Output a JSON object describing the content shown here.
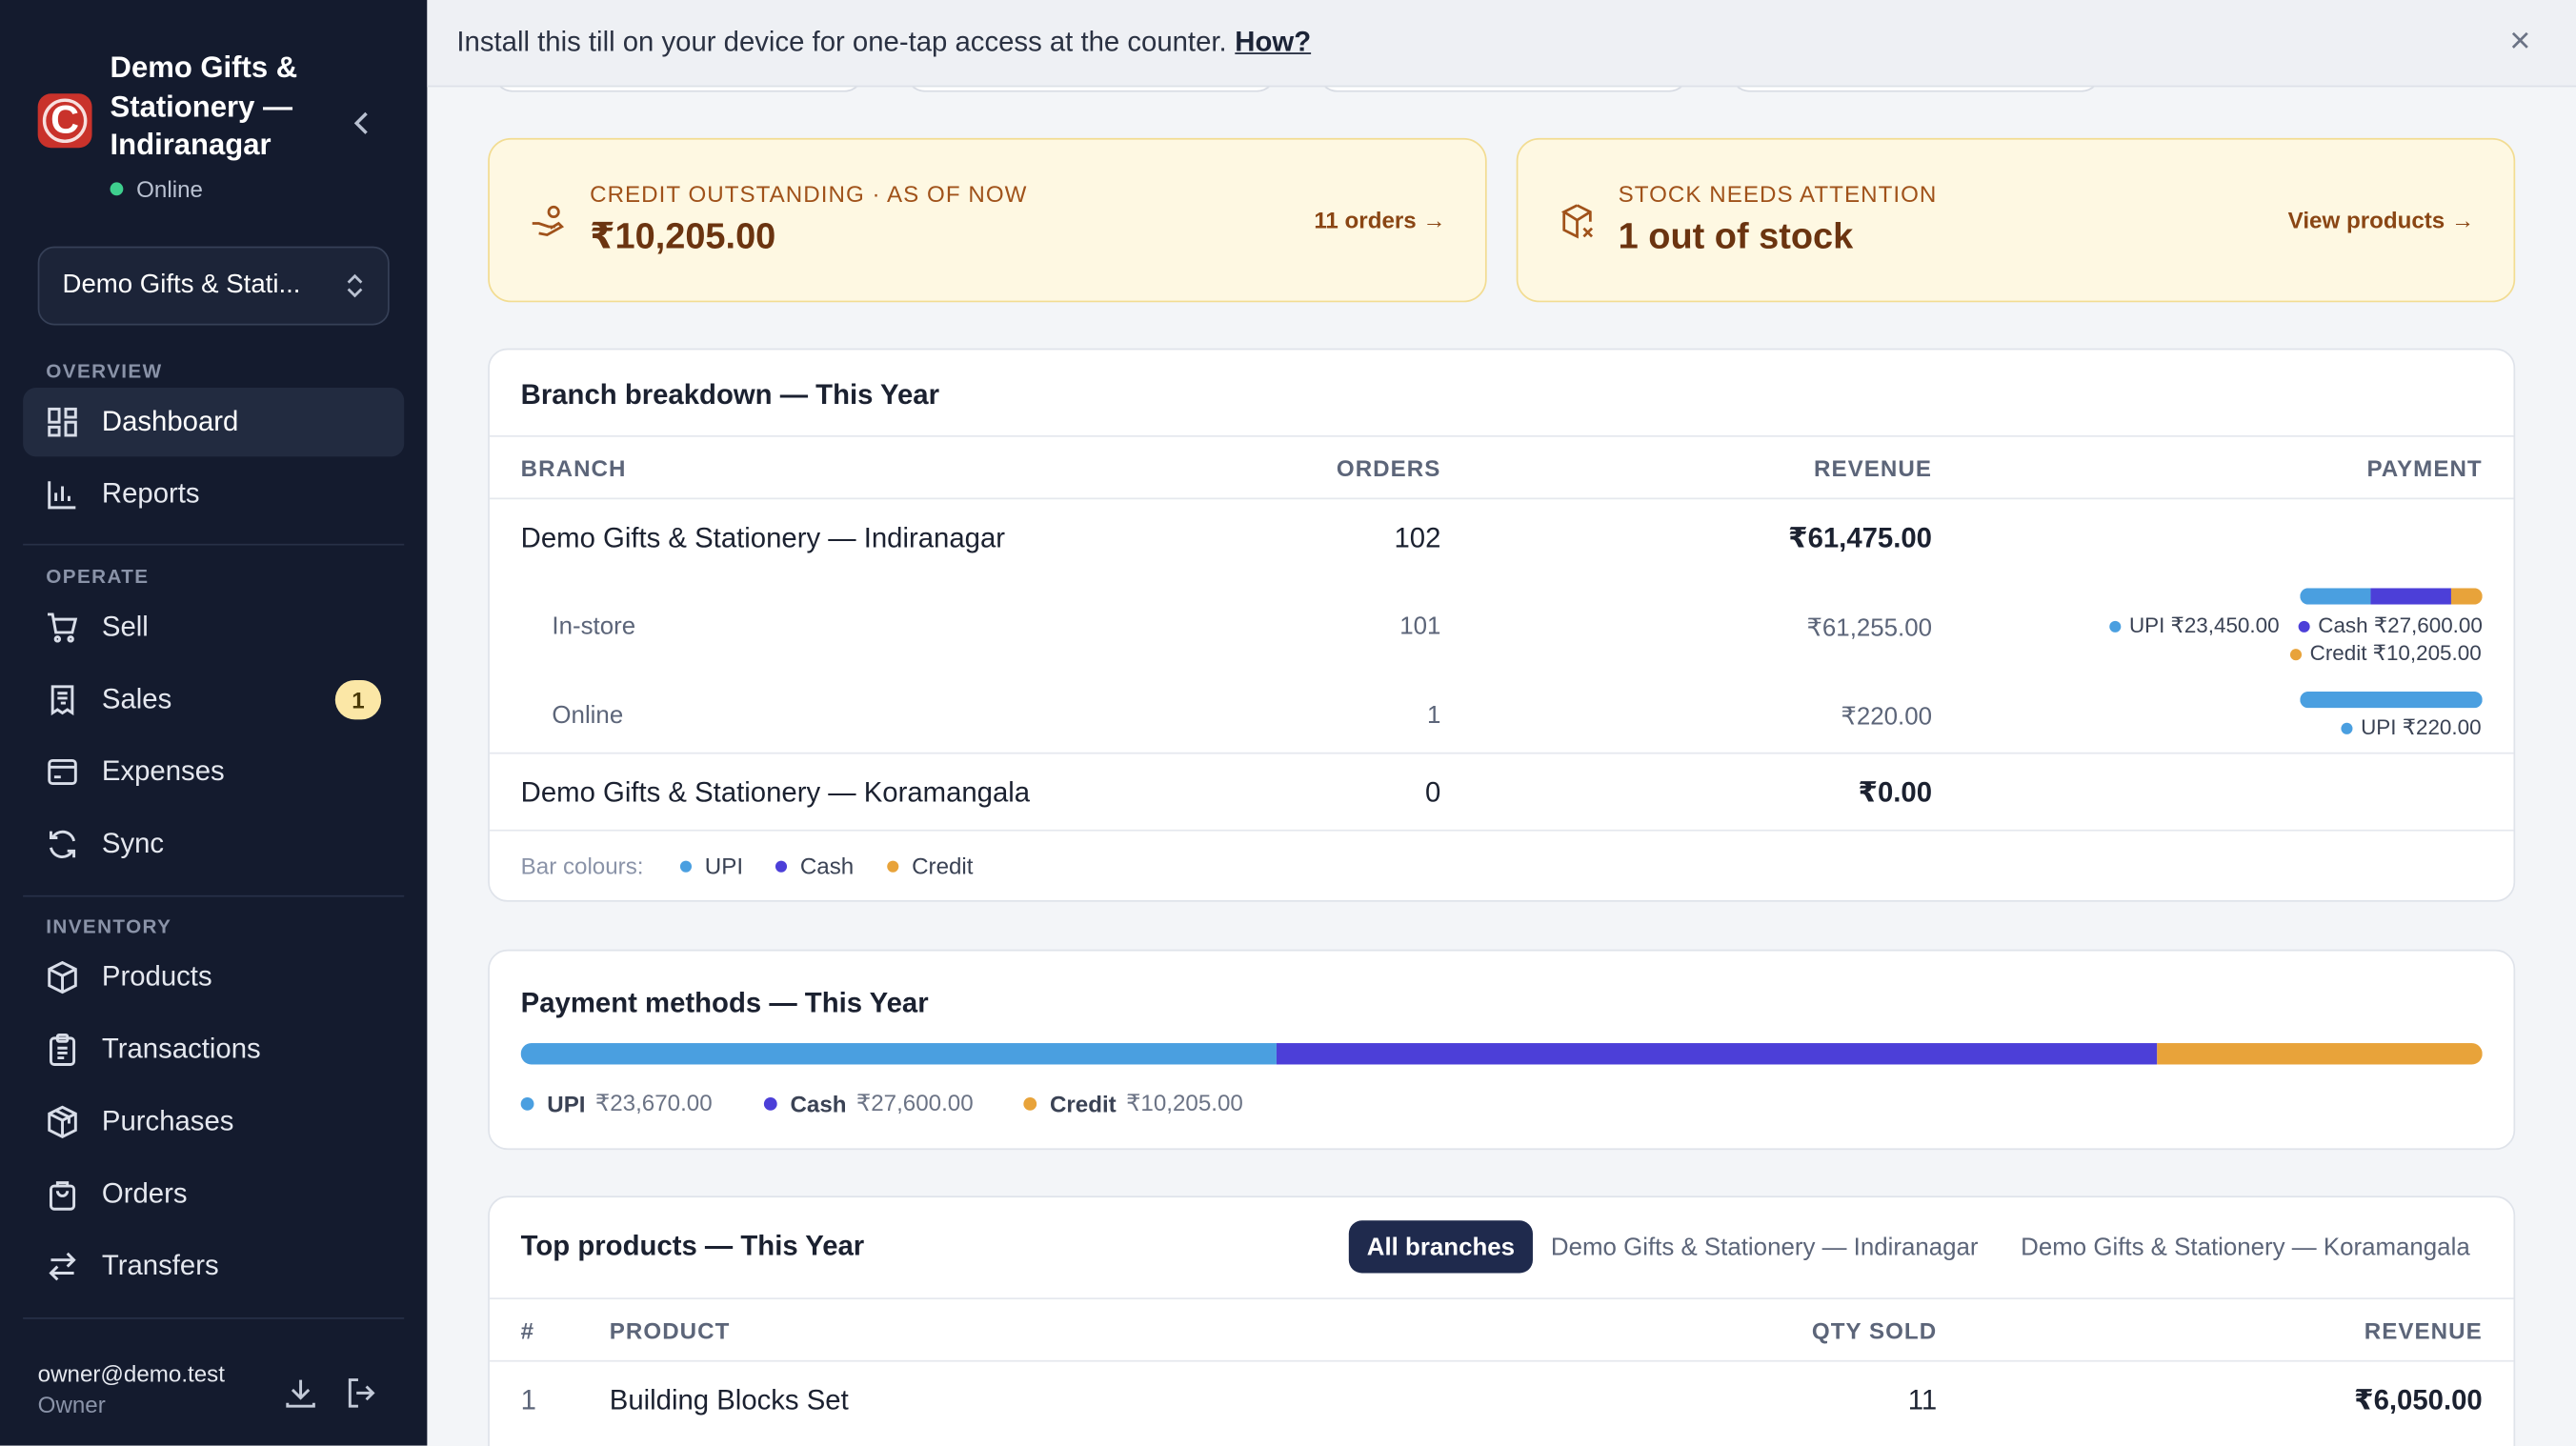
{
  "sidebar": {
    "brand_initial": "C",
    "brand_name": "Demo Gifts & Stationery — Indiranagar",
    "status": "Online",
    "store_selector": "Demo Gifts & Stati...",
    "sections": {
      "overview": "OVERVIEW",
      "operate": "OPERATE",
      "inventory": "INVENTORY"
    },
    "items": {
      "dashboard": "Dashboard",
      "reports": "Reports",
      "sell": "Sell",
      "sales": "Sales",
      "sales_badge": "1",
      "expenses": "Expenses",
      "sync": "Sync",
      "products": "Products",
      "transactions": "Transactions",
      "purchases": "Purchases",
      "orders": "Orders",
      "transfers": "Transfers"
    },
    "user_email": "owner@demo.test",
    "user_role": "Owner"
  },
  "banner": {
    "text": "Install this till on your device for one-tap access at the counter.",
    "link": "How?",
    "close": "×"
  },
  "alerts": {
    "credit": {
      "label": "CREDIT OUTSTANDING · AS OF NOW",
      "value": "₹10,205.00",
      "link": "11 orders →"
    },
    "stock": {
      "label": "STOCK NEEDS ATTENTION",
      "value": "1 out of stock",
      "link": "View products →"
    }
  },
  "branch_breakdown": {
    "title": "Branch breakdown — This Year",
    "headers": {
      "branch": "BRANCH",
      "orders": "ORDERS",
      "revenue": "REVENUE",
      "payment": "PAYMENT"
    },
    "rows": [
      {
        "branch": "Demo Gifts & Stationery — Indiranagar",
        "orders": "102",
        "revenue": "₹61,475.00"
      },
      {
        "branch": "In-store",
        "orders": "101",
        "revenue": "₹61,255.00",
        "legend": [
          "UPI ₹23,450.00",
          "Cash ₹27,600.00",
          "Credit ₹10,205.00"
        ],
        "shares": [
          0.383,
          0.45,
          0.167
        ]
      },
      {
        "branch": "Online",
        "orders": "1",
        "revenue": "₹220.00",
        "legend": [
          "UPI ₹220.00"
        ],
        "shares": [
          1.0
        ]
      },
      {
        "branch": "Demo Gifts & Stationery — Koramangala",
        "orders": "0",
        "revenue": "₹0.00"
      }
    ],
    "bar_colours_label": "Bar colours:",
    "bar_colours": [
      "UPI",
      "Cash",
      "Credit"
    ]
  },
  "payment_methods": {
    "title": "Payment methods — This Year",
    "shares": [
      0.385,
      0.449,
      0.166
    ],
    "legend": [
      {
        "name": "UPI",
        "value": "₹23,670.00"
      },
      {
        "name": "Cash",
        "value": "₹27,600.00"
      },
      {
        "name": "Credit",
        "value": "₹10,205.00"
      }
    ]
  },
  "top_products": {
    "title": "Top products — This Year",
    "tabs": [
      "All branches",
      "Demo Gifts & Stationery — Indiranagar",
      "Demo Gifts & Stationery — Koramangala"
    ],
    "headers": {
      "rank": "#",
      "product": "PRODUCT",
      "qty": "QTY SOLD",
      "revenue": "REVENUE"
    },
    "rows": [
      {
        "rank": "1",
        "product": "Building Blocks Set",
        "qty": "11",
        "revenue": "₹6,050.00"
      }
    ]
  },
  "colors": {
    "upi": "#4a9fe0",
    "cash": "#4c3fd8",
    "credit": "#e8a33a"
  }
}
